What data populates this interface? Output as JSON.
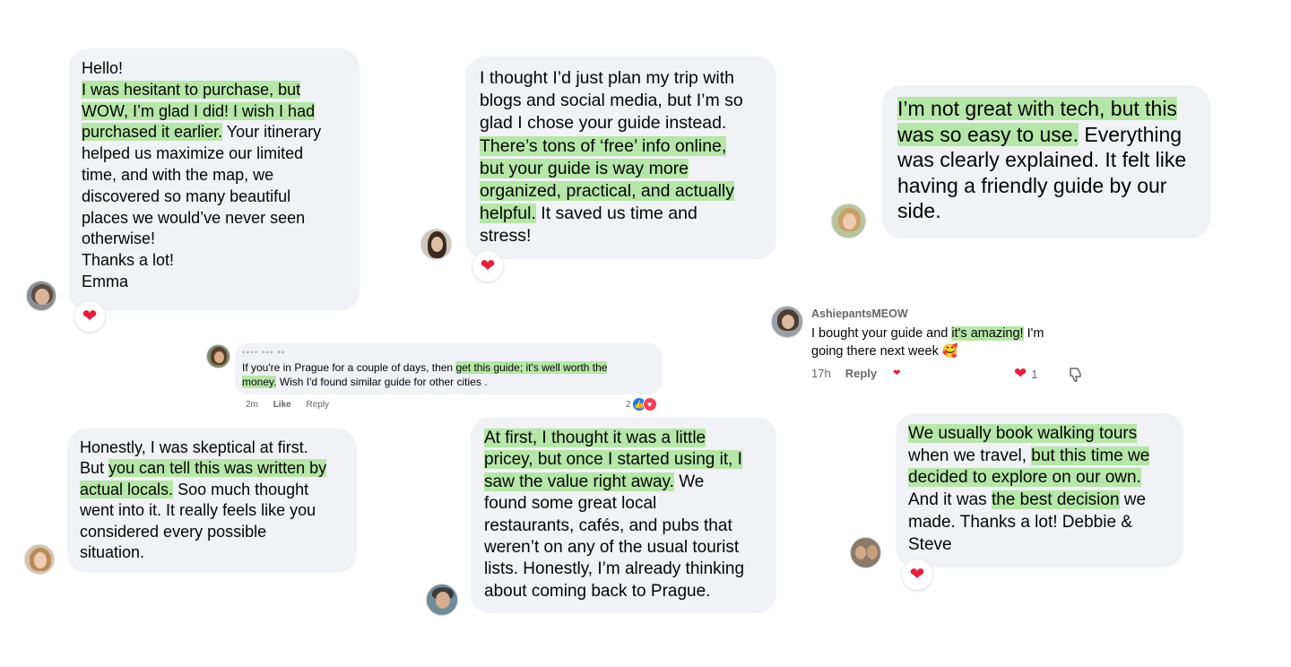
{
  "r1": {
    "lines": [
      [
        {
          "t": "Hello!"
        }
      ],
      [
        {
          "t": "I was hesitant to purchase, but",
          "h": true
        }
      ],
      [
        {
          "t": "WOW, I’m glad I did! I wish I had",
          "h": true
        }
      ],
      [
        {
          "t": "purchased it earlier.",
          "h": true
        },
        {
          "t": " Your itinerary"
        }
      ],
      [
        {
          "t": "helped us maximize our limited"
        }
      ],
      [
        {
          "t": "time, and with the map, we"
        }
      ],
      [
        {
          "t": "discovered so many beautiful"
        }
      ],
      [
        {
          "t": "places we would’ve never seen"
        }
      ],
      [
        {
          "t": "otherwise!"
        }
      ],
      [
        {
          "t": "Thanks a lot!"
        }
      ],
      [
        {
          "t": "Emma"
        }
      ]
    ],
    "reaction": "❤"
  },
  "r2": {
    "lines": [
      [
        {
          "t": "I thought I’d just plan my trip with"
        }
      ],
      [
        {
          "t": "blogs and social media, but I’m so"
        }
      ],
      [
        {
          "t": "glad I chose your guide instead."
        }
      ],
      [
        {
          "t": "There’s tons of ‘free’ info online,",
          "h": true
        }
      ],
      [
        {
          "t": "but your guide is way more",
          "h": true
        }
      ],
      [
        {
          "t": "organized, practical, and actually",
          "h": true
        }
      ],
      [
        {
          "t": "helpful.",
          "h": true
        },
        {
          "t": " It saved us time and"
        }
      ],
      [
        {
          "t": "stress!"
        }
      ]
    ],
    "reaction": "❤"
  },
  "r3": {
    "lines": [
      [
        {
          "t": "I’m not great with tech, but this",
          "h": true
        }
      ],
      [
        {
          "t": "was so easy to use.",
          "h": true
        },
        {
          "t": " Everything"
        }
      ],
      [
        {
          "t": "was clearly explained. It felt like"
        }
      ],
      [
        {
          "t": "having a friendly guide by our"
        }
      ],
      [
        {
          "t": "side."
        }
      ]
    ]
  },
  "r4": {
    "author_blurred": "▪▪▪▪ ▪▪▪ ▪▪",
    "lines": [
      [
        {
          "t": "If you're in Prague for a couple of days, then "
        },
        {
          "t": "get this guide; it's well worth the",
          "h": true
        }
      ],
      [
        {
          "t": "money.",
          "h": true
        },
        {
          "t": " Wish I'd found similar guide for other cities ."
        }
      ]
    ],
    "time": "2m",
    "like_label": "Like",
    "reply_label": "Reply",
    "reaction_count": "2"
  },
  "r5": {
    "author": "AshiepantsMEOW",
    "lines": [
      [
        {
          "t": "I bought your guide and "
        },
        {
          "t": "it's amazing!",
          "h": true
        },
        {
          "t": " I'm"
        }
      ],
      [
        {
          "t": "going there next week 🥰"
        }
      ]
    ],
    "time": "17h",
    "reply_label": "Reply",
    "like_count": "1"
  },
  "r6": {
    "lines": [
      [
        {
          "t": "Honestly, I was skeptical at first."
        }
      ],
      [
        {
          "t": "But "
        },
        {
          "t": "you can tell this was written by",
          "h": true
        }
      ],
      [
        {
          "t": "actual locals.",
          "h": true
        },
        {
          "t": " Soo much thought"
        }
      ],
      [
        {
          "t": "went into it. It really feels like you"
        }
      ],
      [
        {
          "t": "considered every possible"
        }
      ],
      [
        {
          "t": "situation."
        }
      ]
    ]
  },
  "r7": {
    "lines": [
      [
        {
          "t": "At first, I thought it was a little",
          "h": true
        }
      ],
      [
        {
          "t": "pricey, but once I started using it, I",
          "h": true
        }
      ],
      [
        {
          "t": "saw the value right away.",
          "h": true
        },
        {
          "t": " We"
        }
      ],
      [
        {
          "t": "found some great local"
        }
      ],
      [
        {
          "t": "restaurants, cafés, and pubs that"
        }
      ],
      [
        {
          "t": "weren’t on any of the usual tourist"
        }
      ],
      [
        {
          "t": "lists. Honestly, I’m already thinking"
        }
      ],
      [
        {
          "t": "about coming back to Prague."
        }
      ]
    ]
  },
  "r8": {
    "lines": [
      [
        {
          "t": "We usually book walking tours",
          "h": true
        }
      ],
      [
        {
          "t": "when we travel, "
        },
        {
          "t": "but this time we",
          "h": true
        }
      ],
      [
        {
          "t": "decided to explore on our own.",
          "h": true
        }
      ],
      [
        {
          "t": "And it was "
        },
        {
          "t": "the best decision",
          "h": true
        },
        {
          "t": " we"
        }
      ],
      [
        {
          "t": "made. Thanks a lot! Debbie &"
        }
      ],
      [
        {
          "t": "Steve"
        }
      ]
    ],
    "reaction": "❤"
  },
  "colors": {
    "bubble": "#f0f2f5",
    "highlight": "#b6e6a8",
    "heart": "#e41e3f",
    "like_blue": "#1877f2"
  }
}
